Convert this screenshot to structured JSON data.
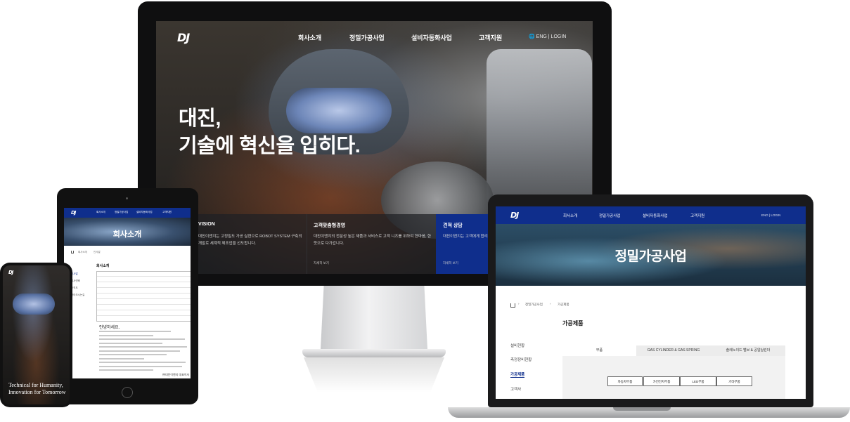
{
  "monitor": {
    "logo": "DJ",
    "nav": [
      "회사소개",
      "정밀가공사업",
      "설비자동화사업",
      "고객지원"
    ],
    "lang": "ENG | LOGIN",
    "hero_line1": "대진,",
    "hero_line2": "기술에 혁신을 입히다.",
    "cards": [
      {
        "title": "VISION",
        "desc": "대진이앤지는 고정밀도 가공 실현으로 ROBOT SYSTEM 구축의 개발로 세계적 제조업을 선도합니다.",
        "more": ""
      },
      {
        "title": "고객맞춤형경영",
        "desc": "대진이앤지의 전문성 높은 제품과 서비스로 고객 니즈를 위하여 한마음, 한뜻으로 다가갑니다.",
        "more": "자세히 보기"
      },
      {
        "title": "견적 상담",
        "desc": "대진이앤지는 고객에게 합리적으로 견적 드리고 최선을 다하고 있습니다.",
        "more": "자세히 보기"
      }
    ]
  },
  "tablet": {
    "logo": "DJ",
    "nav": [
      "회사소개",
      "정밀가공사업",
      "설비자동화사업",
      "고객지원"
    ],
    "banner_title": "회사소개",
    "breadcrumb": [
      "회사소개",
      "인사말"
    ],
    "side": [
      "인사말",
      "회사연혁",
      "조직도",
      "찾아오시는길"
    ],
    "heading": "회사소개",
    "hello": "안녕하세요.",
    "sign": "㈜대진이앤지 대표이사"
  },
  "phone": {
    "logo": "DJ",
    "text": "Technical for Humanity, Innovation for Tomorrow"
  },
  "laptop": {
    "logo": "DJ",
    "nav": [
      "회사소개",
      "정밀가공사업",
      "설비자동화사업",
      "고객지원"
    ],
    "lang": "ENG | LOGIN",
    "banner_title": "정밀가공사업",
    "breadcrumb": [
      "정밀가공사업",
      "가공제품"
    ],
    "heading": "가공제품",
    "side": [
      "설비현황",
      "측정장비현황",
      "가공제품",
      "고객사"
    ],
    "tabs": [
      "부품",
      "GAS CYLINDER & GAS SPRING",
      "솔레노이드 밸브 & 공압실린더"
    ],
    "buttons": [
      "자동차부품",
      "가전전자부품",
      "LED부품",
      "기타부품"
    ]
  }
}
